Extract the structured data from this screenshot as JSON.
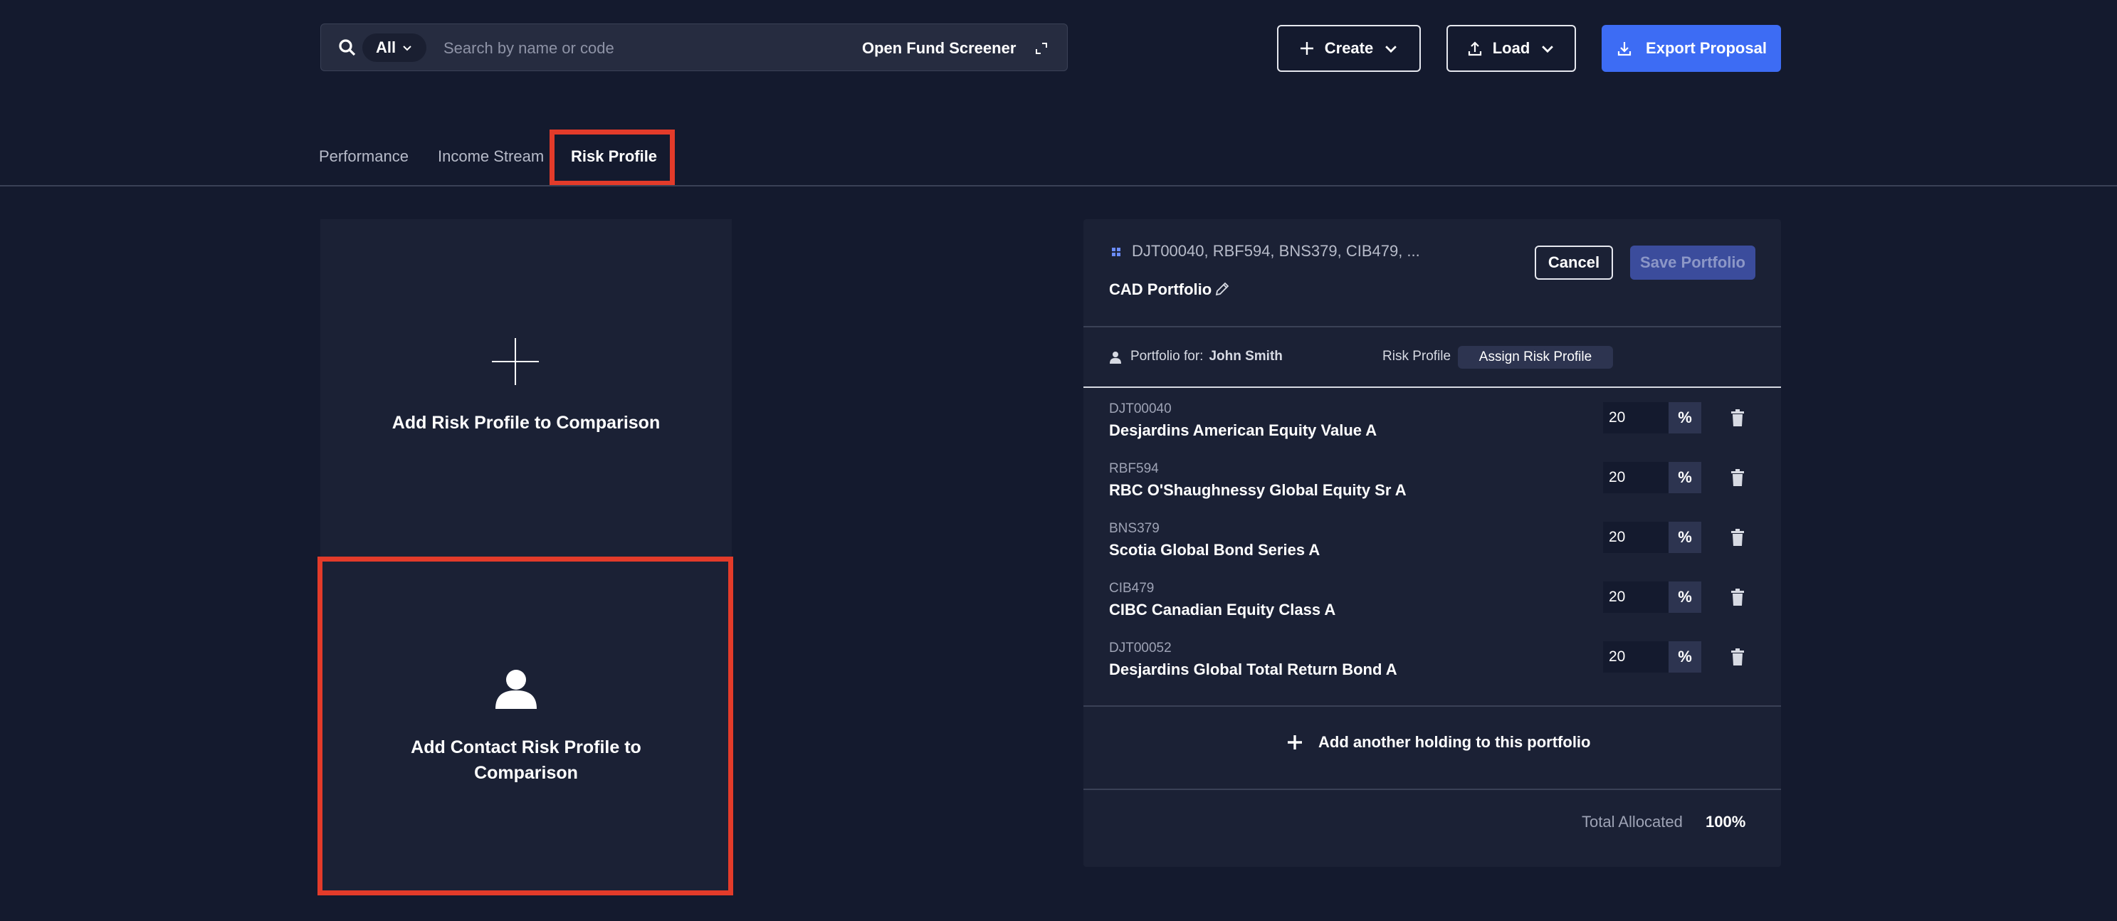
{
  "search": {
    "filter_label": "All",
    "placeholder": "Search by name or code",
    "screener_label": "Open Fund Screener"
  },
  "toolbar": {
    "create_label": "Create",
    "load_label": "Load",
    "export_label": "Export Proposal"
  },
  "tabs": [
    {
      "label": "Performance"
    },
    {
      "label": "Income Stream"
    },
    {
      "label": "Risk Profile"
    }
  ],
  "active_tab": "Risk Profile",
  "comparison": {
    "add_risk_profile": "Add Risk Profile to Comparison",
    "add_contact_line1": "Add Contact Risk Profile to",
    "add_contact_line2": "Comparison"
  },
  "portfolio": {
    "codes": "DJT00040, RBF594, BNS379, CIB479, ...",
    "name": "CAD Portfolio",
    "cancel_label": "Cancel",
    "save_label": "Save Portfolio",
    "portfolio_for_label": "Portfolio for:",
    "client_name": "John Smith",
    "risk_profile_label": "Risk Profile",
    "assign_label": "Assign Risk Profile",
    "holdings": [
      {
        "code": "DJT00040",
        "name": "Desjardins American Equity Value A",
        "pct": "20",
        "unit": "%"
      },
      {
        "code": "RBF594",
        "name": "RBC O'Shaughnessy Global Equity Sr A",
        "pct": "20",
        "unit": "%"
      },
      {
        "code": "BNS379",
        "name": "Scotia Global Bond Series A",
        "pct": "20",
        "unit": "%"
      },
      {
        "code": "CIB479",
        "name": "CIBC Canadian Equity Class A",
        "pct": "20",
        "unit": "%"
      },
      {
        "code": "DJT00052",
        "name": "Desjardins Global Total Return Bond A",
        "pct": "20",
        "unit": "%"
      }
    ],
    "add_holding_label": "Add another holding to this portfolio",
    "total_label": "Total Allocated",
    "total_value": "100%"
  },
  "colors": {
    "background": "#141a2e",
    "panel": "#1b2135",
    "accent": "#3d6cf4",
    "highlight": "#e33b2a"
  }
}
